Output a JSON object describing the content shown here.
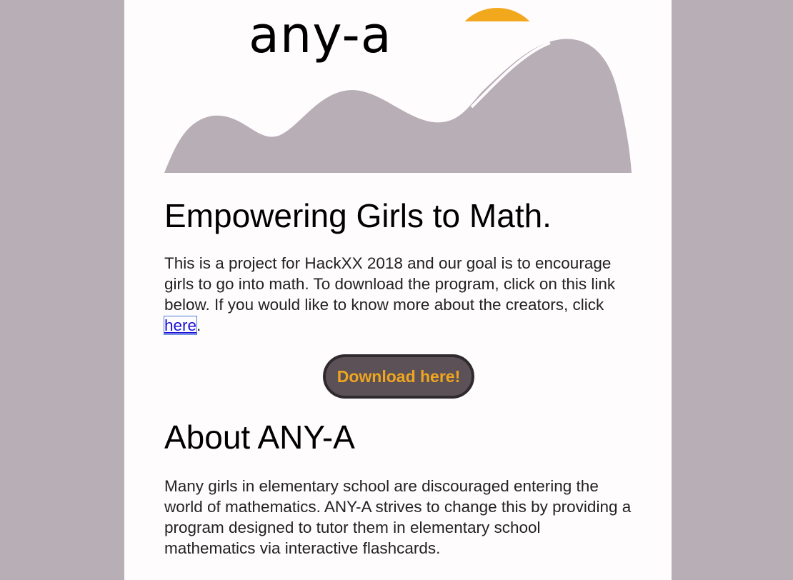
{
  "brand": {
    "logo_text": "any-a",
    "sun_color": "#f2a81d",
    "mountain_color": "#b8aeb6"
  },
  "hero_heading": "Empowering Girls to Math.",
  "intro": {
    "text_before_link": "This is a project for HackXX 2018 and our goal is to encourage girls to go into math. To download the program, click on this link below. If you would like to know more about the creators, click ",
    "link_label": "here",
    "text_after_link": "."
  },
  "download_button": {
    "label": "Download here!"
  },
  "about": {
    "heading": "About ANY-A",
    "text": "Many girls in elementary school are discouraged entering the world of mathematics. ANY-A strives to change this by providing a program designed to tutor them in elementary school mathematics via interactive flashcards."
  }
}
